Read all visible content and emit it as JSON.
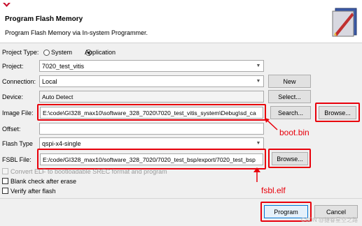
{
  "header": {
    "title": "Program Flash Memory",
    "description": "Program Flash Memory via In-system Programmer."
  },
  "form": {
    "project_type_label": "Project Type:",
    "project_type_options": [
      "System",
      "Application"
    ],
    "project_type_selected": "Application",
    "project_label": "Project:",
    "project_value": "7020_test_vitis",
    "connection_label": "Connection:",
    "connection_value": "Local",
    "new_button": "New",
    "device_label": "Device:",
    "device_value": "Auto Detect",
    "select_button": "Select...",
    "image_file_label": "Image File:",
    "image_file_value": "E:\\code\\GI328_max10\\software_328_7020\\7020_test_vitis_system\\Debug\\sd_ca",
    "search_button": "Search...",
    "browse_button": "Browse...",
    "offset_label": "Offset:",
    "offset_value": "",
    "flash_type_label": "Flash Type",
    "flash_type_value": "qspi-x4-single",
    "fsbl_file_label": "FSBL File:",
    "fsbl_file_value": "E:/code/GI328_max10/software_328_7020/7020_test_bsp/export/7020_test_bsp",
    "fsbl_browse_button": "Browse...",
    "convert_elf_label": "Convert ELF to bootloadable SREC format and program",
    "blank_check_label": "Blank check after erase",
    "verify_label": "Verify after flash"
  },
  "annotations": {
    "boot_bin": "boot.bin",
    "fsbl_elf": "fsbl.elf"
  },
  "footer": {
    "program_button": "Program",
    "cancel_button": "Cancel",
    "watermark": "CSDN @捷眷星空之路"
  },
  "colors": {
    "annotation_red": "#e8000b",
    "dialog_bg": "#f0f0f0"
  }
}
